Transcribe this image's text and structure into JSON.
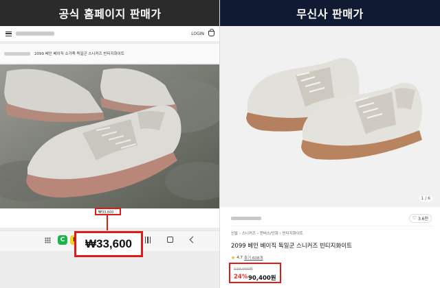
{
  "left": {
    "banner": "공식 홈페이지 판매가",
    "header": {
      "login_label": "LOGIN"
    },
    "product_title": "2099 베인 베이직 소가죽 독일군 스니커즈 빈티지화이트",
    "small_price": "₩33,600",
    "big_price": "₩33,600",
    "apps": {
      "green_app_label": "C",
      "yellow_app_label": "b"
    }
  },
  "right": {
    "banner": "무신사 판매가",
    "image_counter": "1 / 6",
    "like_count": "3.6천",
    "breadcrumb": "신발 › 스니커즈 › 캔버스/단화 › 빈티지화이트",
    "product_name": "2099 베인 베이직 독일군 스니커즈 빈티지화이트",
    "rating": "4.7",
    "reviews": "후기 608개",
    "original_price": "119,000원",
    "discount": "24%",
    "sale_price": "90,400원"
  },
  "colors": {
    "highlight": "#e01919",
    "discount": "#e7322a",
    "left_banner_bg": "#2b2b2b",
    "right_banner_bg": "#111a33"
  },
  "icons": [
    "hamburger-icon",
    "cart-icon",
    "apps-grid-icon",
    "recents-icon",
    "home-icon",
    "back-icon",
    "heart-icon",
    "star-icon"
  ]
}
